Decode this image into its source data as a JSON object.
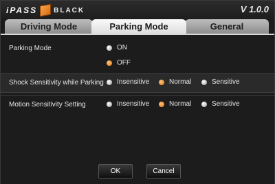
{
  "app": {
    "brand_prefix": "iPASS",
    "brand_suffix": "BLACK",
    "version": "V 1.0.0"
  },
  "tabs": [
    {
      "label": "Driving Mode",
      "active": false
    },
    {
      "label": "Parking Mode",
      "active": true
    },
    {
      "label": "General",
      "active": false
    }
  ],
  "settings": {
    "parking_mode": {
      "label": "Parking Mode",
      "options": [
        "ON",
        "OFF"
      ],
      "selected": "OFF"
    },
    "shock_sensitivity": {
      "label": "Shock Sensitivity while Parking",
      "options": [
        "Insensitive",
        "Normal",
        "Sensitive"
      ],
      "selected": "Normal"
    },
    "motion_sensitivity": {
      "label": "Motion Sensitivity Setting",
      "options": [
        "Insensitive",
        "Normal",
        "Sensitive"
      ],
      "selected": "Normal"
    }
  },
  "buttons": {
    "ok": "OK",
    "cancel": "Cancel"
  },
  "colors": {
    "accent": "#f08a1c",
    "background": "#1c1c1c"
  },
  "icons": {
    "logo": "cube-logo-icon",
    "radio_selected": "radio-selected-icon",
    "radio_unselected": "radio-unselected-icon"
  }
}
